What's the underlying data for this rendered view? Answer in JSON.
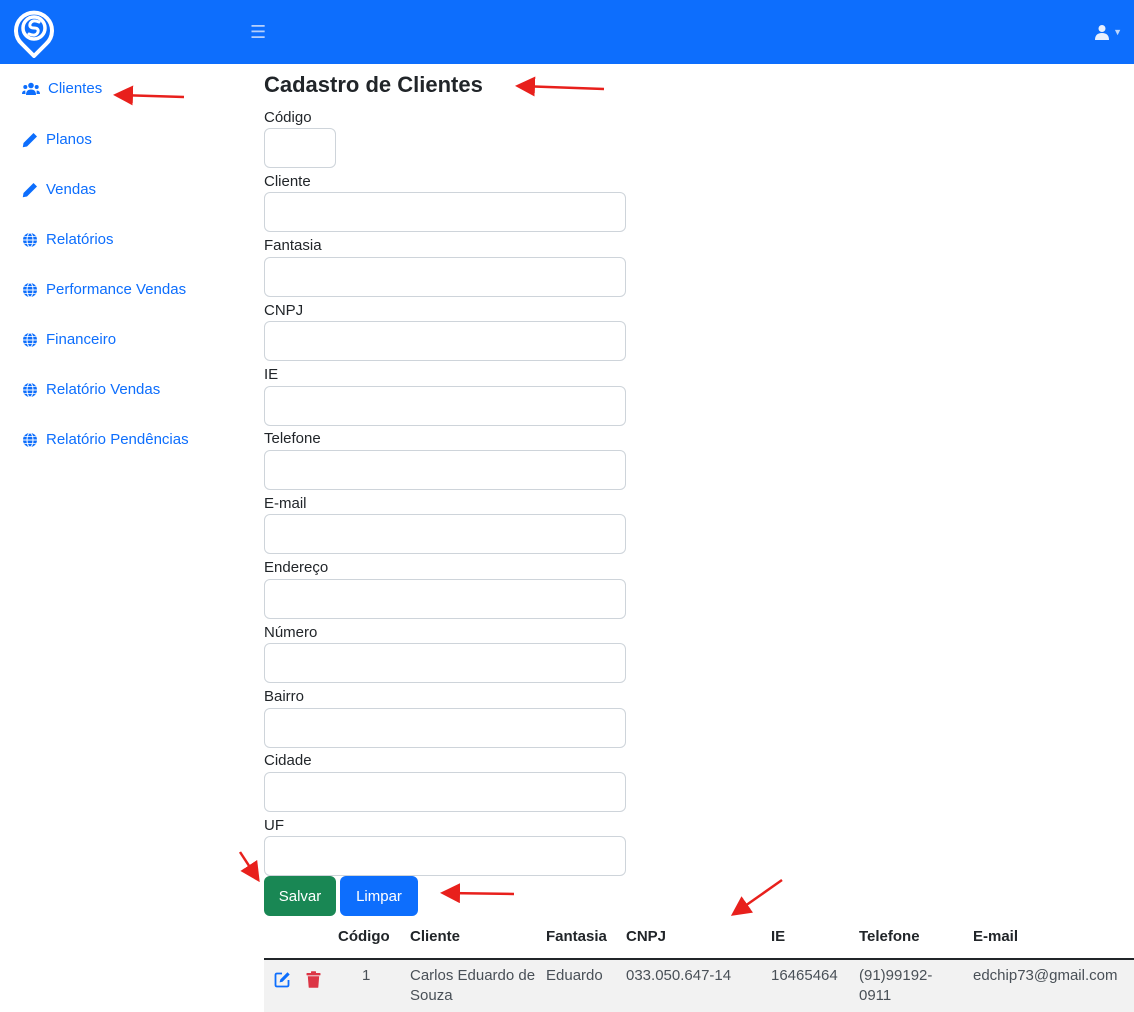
{
  "sidebar": {
    "items": [
      {
        "label": "Clientes",
        "icon": "users-icon"
      },
      {
        "label": "Planos",
        "icon": "pencil-icon"
      },
      {
        "label": "Vendas",
        "icon": "pencil-icon"
      },
      {
        "label": "Relatórios",
        "icon": "globe-icon"
      },
      {
        "label": "Performance Vendas",
        "icon": "globe-icon"
      },
      {
        "label": "Financeiro",
        "icon": "globe-icon"
      },
      {
        "label": "Relatório Vendas",
        "icon": "globe-icon"
      },
      {
        "label": "Relatório Pendências",
        "icon": "globe-icon"
      }
    ]
  },
  "main": {
    "title": "Cadastro de Clientes",
    "fields": {
      "codigo": {
        "label": "Código",
        "value": ""
      },
      "cliente": {
        "label": "Cliente",
        "value": ""
      },
      "fantasia": {
        "label": "Fantasia",
        "value": ""
      },
      "cnpj": {
        "label": "CNPJ",
        "value": ""
      },
      "ie": {
        "label": "IE",
        "value": ""
      },
      "telefone": {
        "label": "Telefone",
        "value": ""
      },
      "email": {
        "label": "E-mail",
        "value": ""
      },
      "endereco": {
        "label": "Endereço",
        "value": ""
      },
      "numero": {
        "label": "Número",
        "value": ""
      },
      "bairro": {
        "label": "Bairro",
        "value": ""
      },
      "cidade": {
        "label": "Cidade",
        "value": ""
      },
      "uf": {
        "label": "UF",
        "value": ""
      }
    },
    "buttons": {
      "save": "Salvar",
      "clear": "Limpar"
    }
  },
  "table": {
    "headers": [
      "Código",
      "Cliente",
      "Fantasia",
      "CNPJ",
      "IE",
      "Telefone",
      "E-mail"
    ],
    "rows": [
      {
        "codigo": "1",
        "cliente": "Carlos Eduardo de Souza",
        "fantasia": "Eduardo",
        "cnpj": "033.050.647-14",
        "ie": "16465464",
        "telefone": "(91)99192-0911",
        "email": "edchip73@gmail.com"
      }
    ]
  },
  "colors": {
    "primary": "#0d6efd",
    "success": "#198754",
    "danger": "#dc3545",
    "annotation": "#e8201c"
  }
}
